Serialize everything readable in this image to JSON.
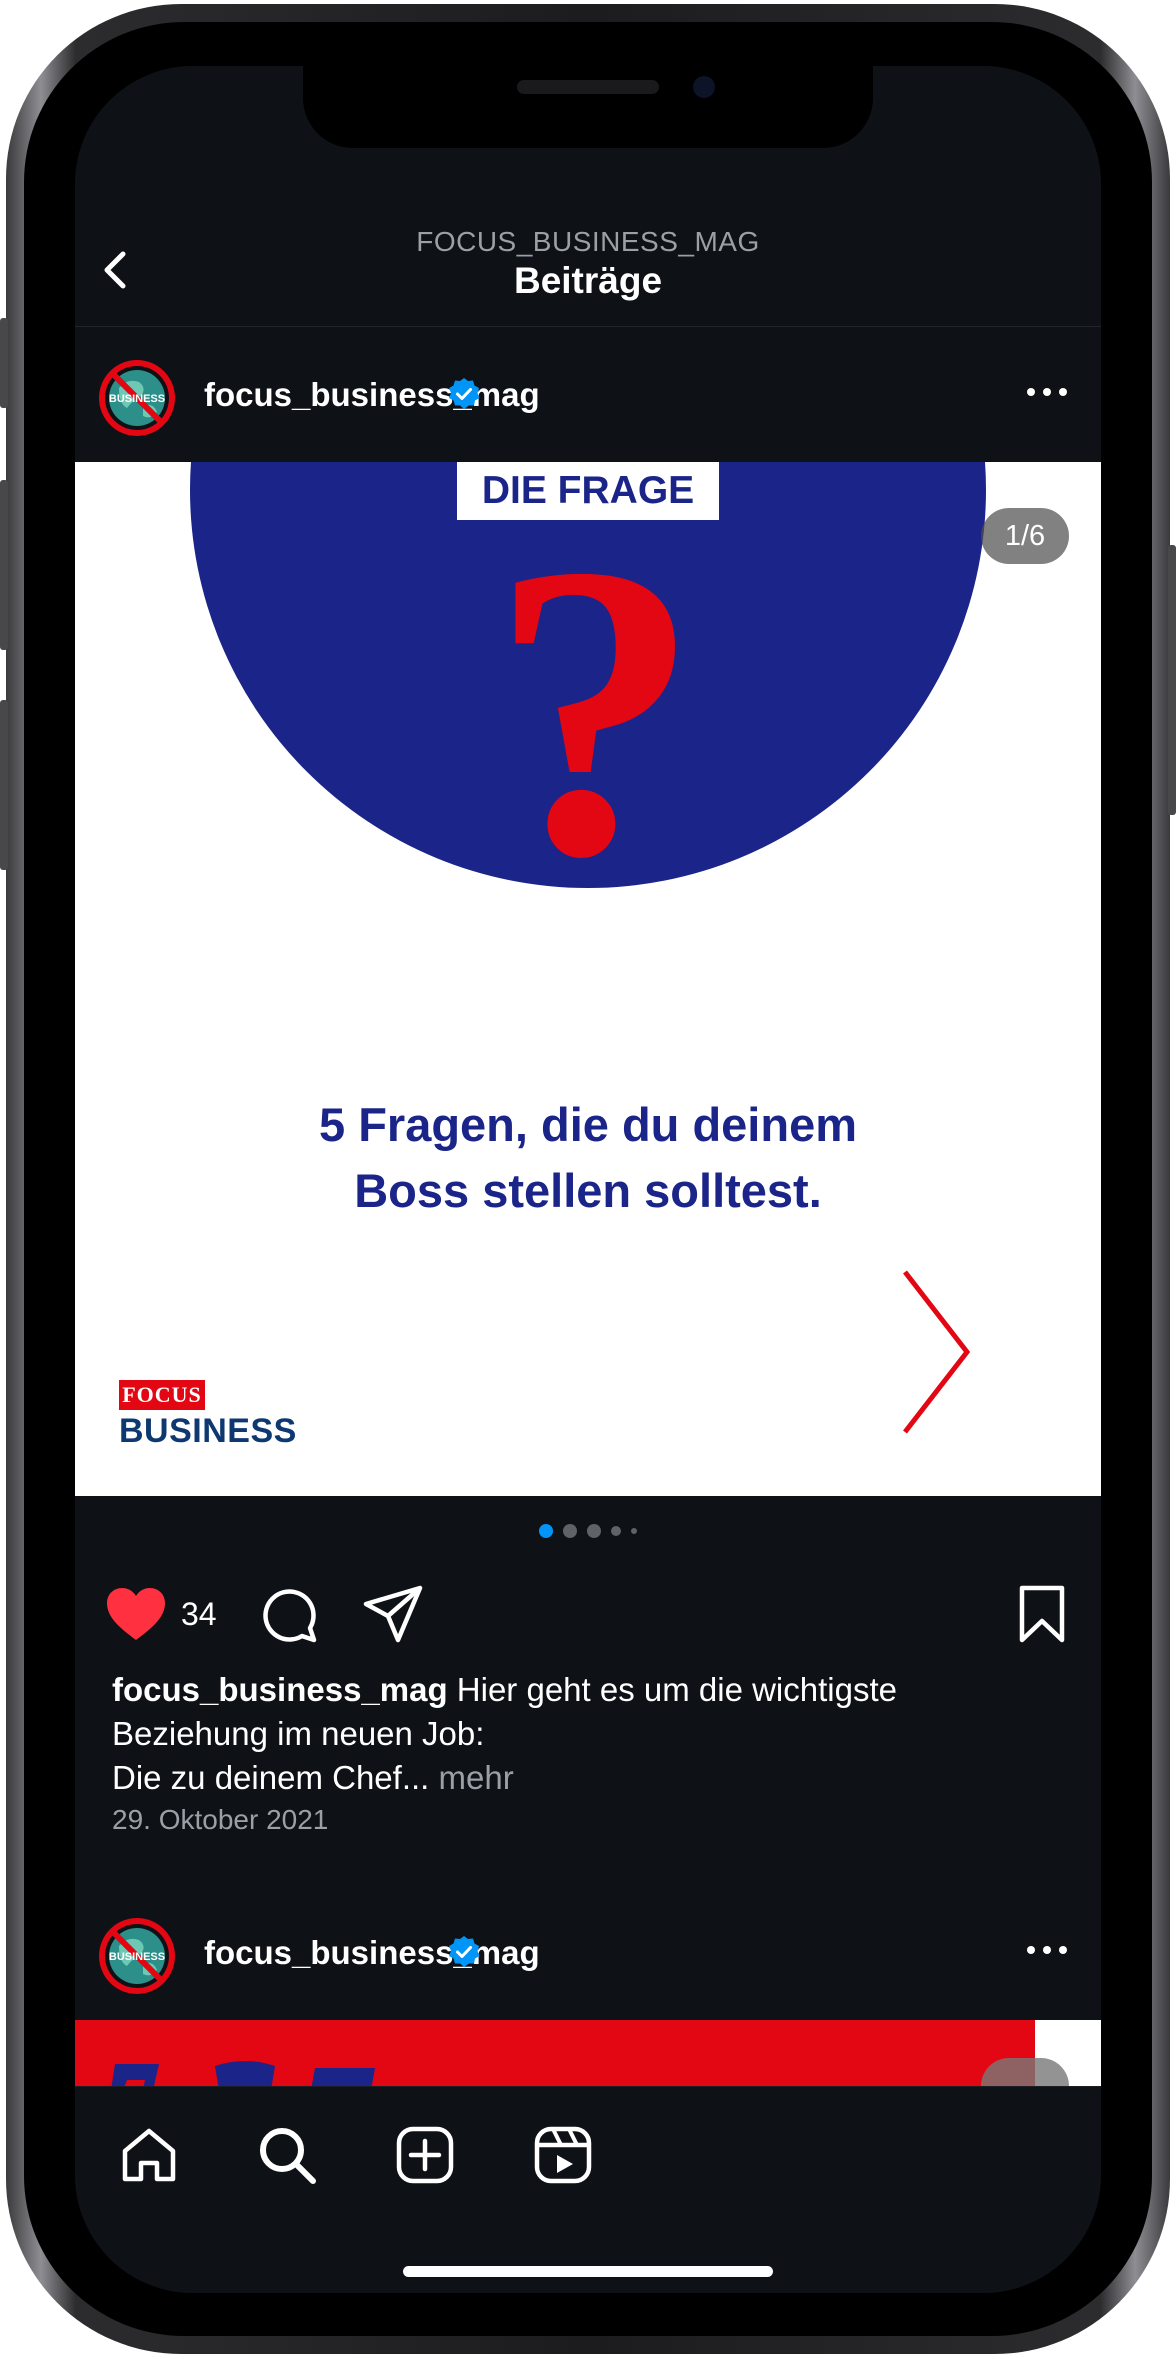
{
  "header": {
    "subtitle": "FOCUS_BUSINESS_MAG",
    "title": "Beiträge"
  },
  "post": {
    "username": "focus_business_mag",
    "avatar_text": "BUSINESS",
    "slide": {
      "tag": "DIE FRAGE",
      "headline_line1": "5 Fragen, die du deinem",
      "headline_line2": "Boss stellen solltest.",
      "brand_focus": "FOCUS",
      "brand_business": "BUSINESS",
      "counter": "1/6",
      "current_index": 1,
      "total": 6
    },
    "likes": "34",
    "caption_user": "focus_business_mag",
    "caption_text": " Hier geht es um die wichtigste Beziehung im neuen Job:",
    "caption_line2": "Die zu deinem Chef... ",
    "caption_more": "mehr",
    "date": "29. Oktober 2021"
  },
  "next_post": {
    "username": "focus_business_mag",
    "avatar_text": "BUSINESS"
  },
  "colors": {
    "accent_blue": "#1b2488",
    "brand_red": "#e30613",
    "active_dot": "#0095f6",
    "verified": "#0095f6"
  },
  "icons": [
    "back-icon",
    "verified-icon",
    "more-icon",
    "heart-icon",
    "comment-icon",
    "share-icon",
    "bookmark-icon",
    "home-icon",
    "search-icon",
    "create-icon",
    "reels-icon"
  ]
}
